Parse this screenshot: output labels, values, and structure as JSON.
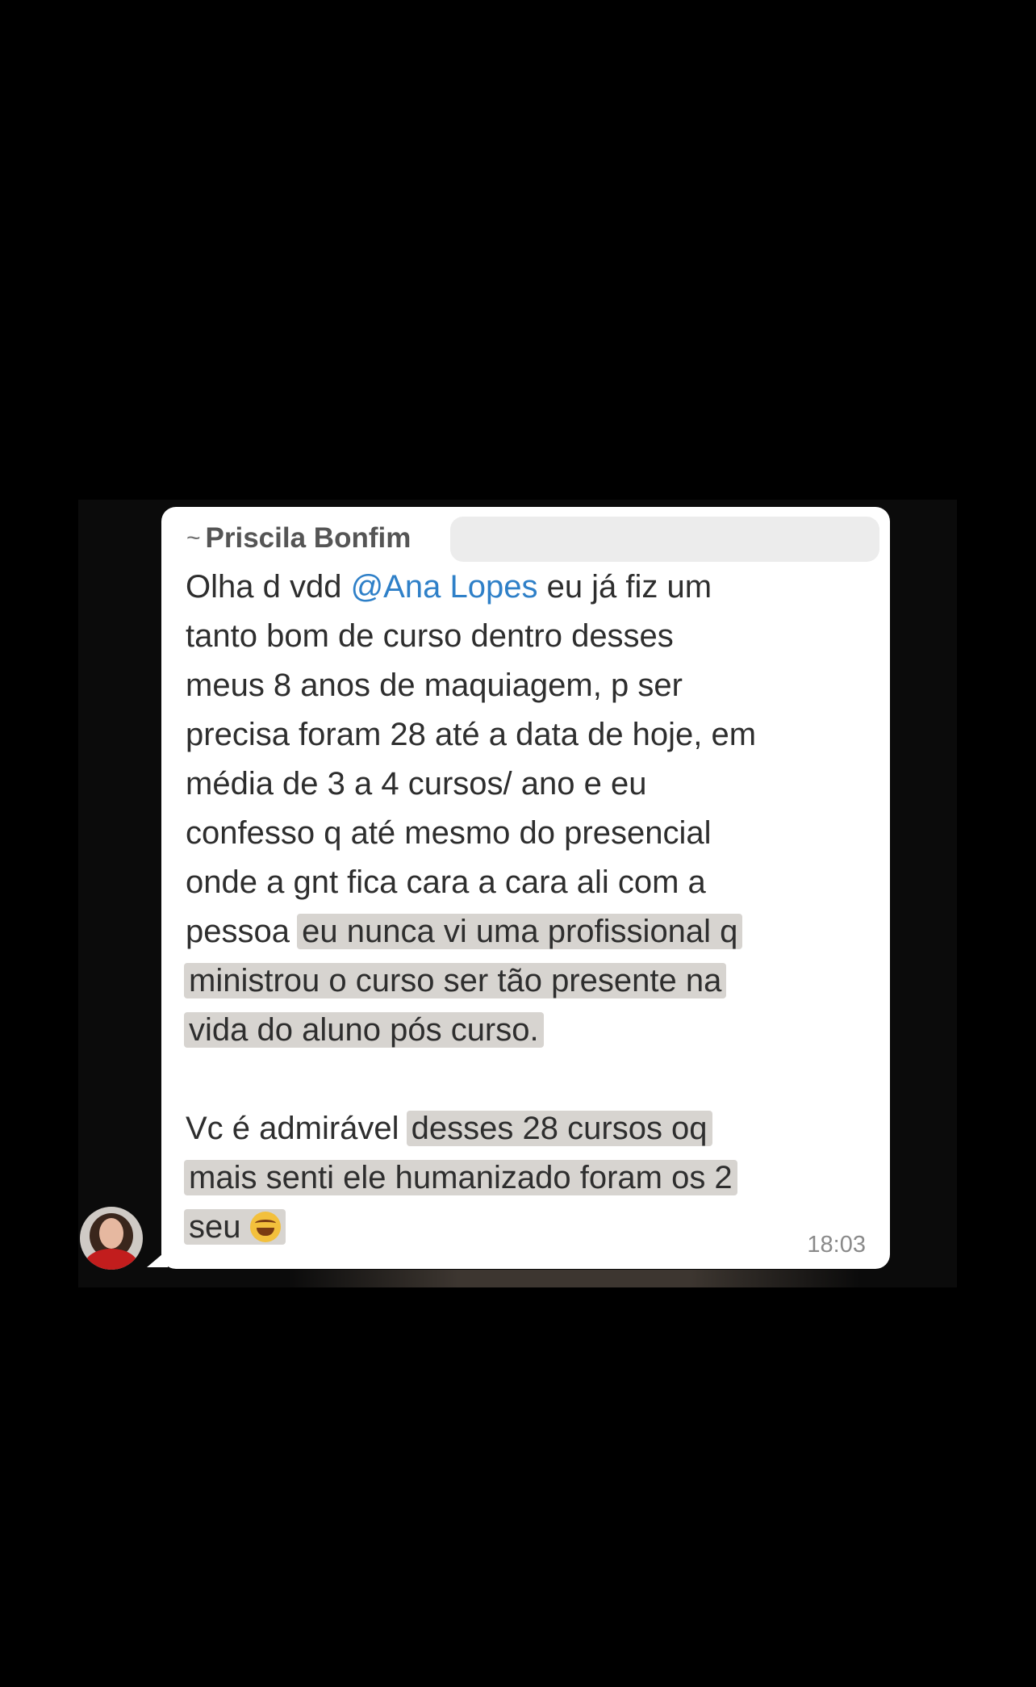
{
  "message": {
    "sender_prefix": "~",
    "sender_name": "Priscila Bonfim",
    "lines": [
      {
        "before": "Olha d vdd ",
        "mention": "@Ana Lopes",
        "after": " eu já fiz um"
      },
      {
        "text": "tanto bom de curso dentro desses"
      },
      {
        "text": "meus 8 anos de maquiagem, p ser"
      },
      {
        "text": "precisa foram 28 até a data de hoje, em"
      },
      {
        "text": "média de 3 a 4 cursos/ ano e eu"
      },
      {
        "text": "confesso q até mesmo do presencial"
      },
      {
        "text": "onde a gnt fica cara a cara ali com a"
      },
      {
        "plain": "pessoa ",
        "highlight": "eu nunca vi uma profissional q"
      },
      {
        "highlight": "ministrou o curso ser tão presente na"
      },
      {
        "highlight": "vida do aluno pós curso."
      },
      {
        "plain": "Vc é admirável ",
        "highlight": "desses 28 cursos oq"
      },
      {
        "highlight": "mais senti ele humanizado foram os 2"
      },
      {
        "highlight": "seu "
      }
    ],
    "time": "18:03",
    "emoji": "rolling-on-floor-laughing-emoji"
  }
}
